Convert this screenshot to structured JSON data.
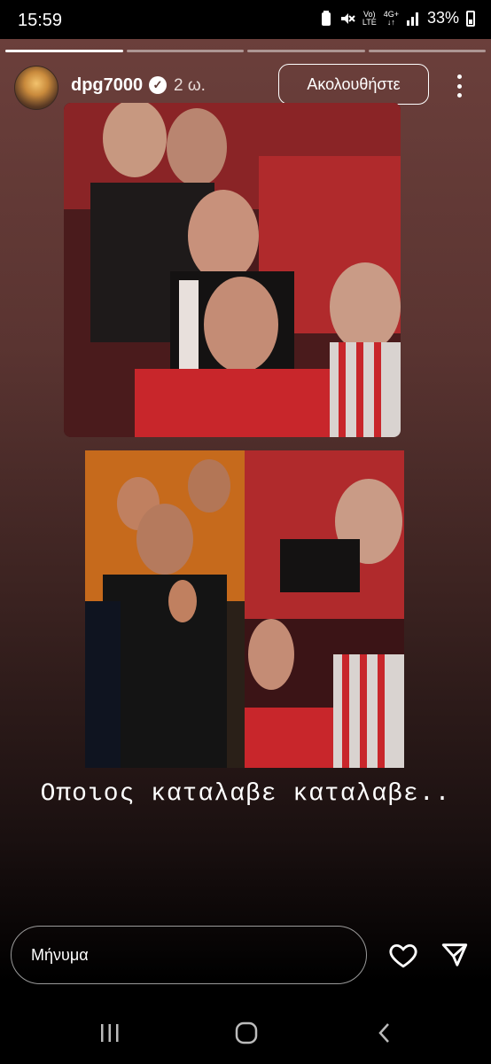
{
  "status_bar": {
    "time": "15:59",
    "network_top": "Vo)",
    "network_bottom": "LTE",
    "net4g_top": "4G+",
    "net4g_bottom": "↓↑",
    "battery": "33%"
  },
  "story": {
    "username": "dpg7000",
    "time_ago": "2 ω.",
    "follow_label": "Ακολουθήστε",
    "caption": "Οποιος καταλαβε καταλαβε..",
    "progress_segments": 4,
    "active_segment": 1
  },
  "reply": {
    "placeholder": "Μήνυμα"
  },
  "icons": {
    "verified": "verified-badge-icon",
    "more": "more-options-icon",
    "like": "heart-icon",
    "send": "send-icon",
    "recent": "recent-apps-icon",
    "home": "home-icon",
    "back": "back-icon"
  },
  "colors": {
    "gradient_top": "#6b3f3b",
    "gradient_bottom": "#000000"
  }
}
